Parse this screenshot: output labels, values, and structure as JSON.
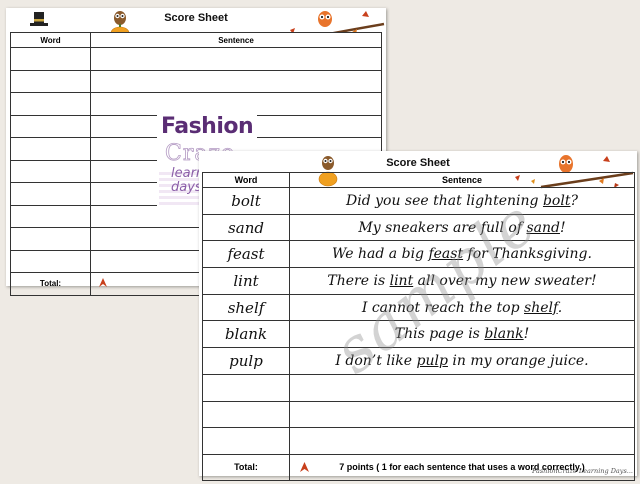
{
  "back_sheet": {
    "title": "Score Sheet",
    "col_word": "Word",
    "col_sentence": "Sentence",
    "row_count": 10,
    "total_label": "Total:"
  },
  "front_sheet": {
    "title": "Score Sheet",
    "col_word": "Word",
    "col_sentence": "Sentence",
    "rows": [
      {
        "word": "bolt",
        "sentence": [
          {
            "t": "Did you see that lightening "
          },
          {
            "u": "bolt"
          },
          {
            "t": "?"
          }
        ]
      },
      {
        "word": "sand",
        "sentence": [
          {
            "t": "My sneakers are full of "
          },
          {
            "u": "sand"
          },
          {
            "t": "!"
          }
        ]
      },
      {
        "word": "feast",
        "sentence": [
          {
            "t": "We had a big "
          },
          {
            "u": "feast"
          },
          {
            "t": " for Thanksgiving."
          }
        ]
      },
      {
        "word": "lint",
        "sentence": [
          {
            "t": "There is "
          },
          {
            "u": "lint"
          },
          {
            "t": " all over my new sweater!"
          }
        ]
      },
      {
        "word": "shelf",
        "sentence": [
          {
            "t": "I cannot reach the top "
          },
          {
            "u": "shelf"
          },
          {
            "t": "."
          }
        ]
      },
      {
        "word": "blank",
        "sentence": [
          {
            "t": "This page is "
          },
          {
            "u": "blank"
          },
          {
            "t": "!"
          }
        ]
      },
      {
        "word": "pulp",
        "sentence": [
          {
            "t": "I don’t like "
          },
          {
            "u": "pulp"
          },
          {
            "t": " in my orange juice."
          }
        ]
      },
      {
        "word": "",
        "sentence": []
      },
      {
        "word": "",
        "sentence": []
      },
      {
        "word": "",
        "sentence": []
      }
    ],
    "total_label": "Total:",
    "total_note": "7 points ( 1 for each sentence that uses a word correctly.)"
  },
  "logo": {
    "line1": "Fashion",
    "line2": "Craze",
    "line3": "learning days..."
  },
  "watermark": "sample",
  "credit": "FashionCraze Learning Days...",
  "colors": {
    "owl": "#e8742c",
    "pumpkin": "#f0a020",
    "leaf": "#c8401c",
    "logo_purple": "#5a2d74"
  }
}
